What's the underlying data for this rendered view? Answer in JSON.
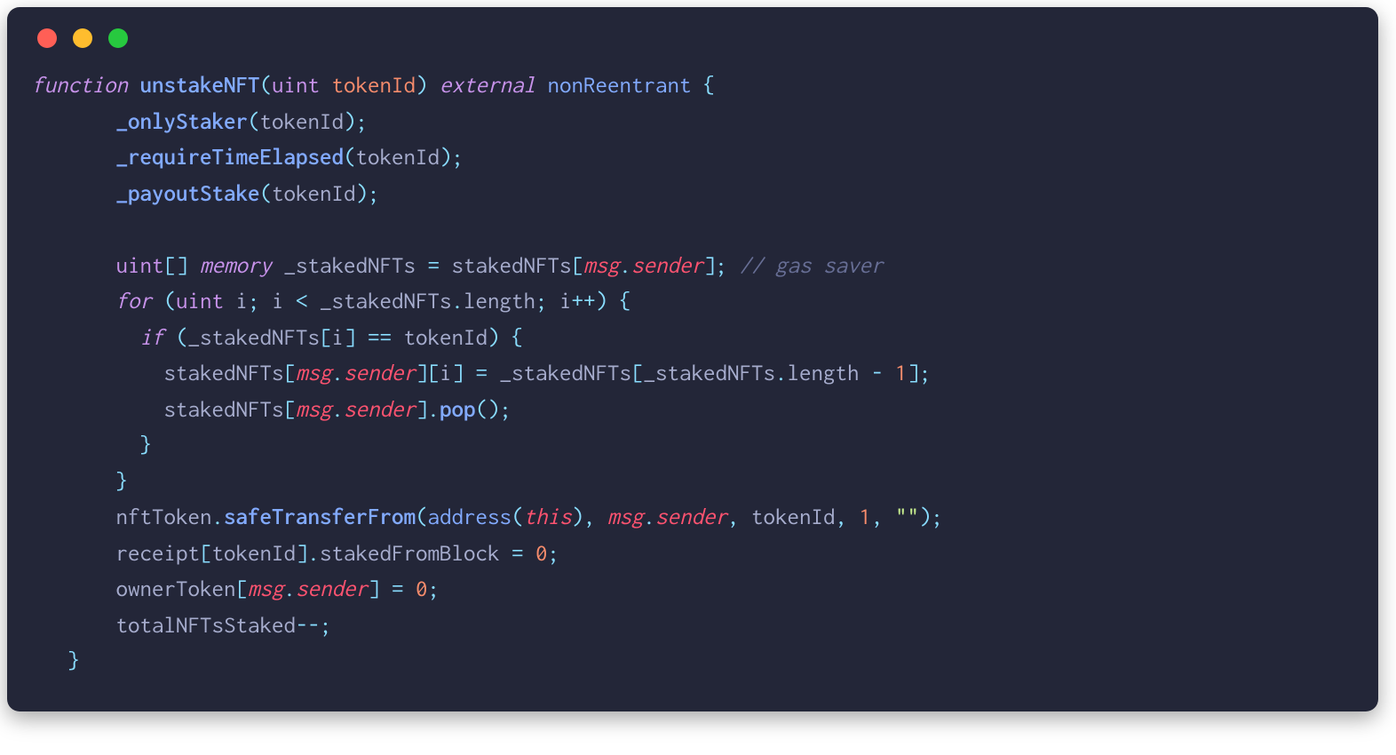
{
  "window": {
    "traffic_lights": {
      "red": "close",
      "yellow": "minimize",
      "green": "zoom"
    }
  },
  "code": {
    "lines": [
      {
        "tokens": [
          {
            "c": "tk-kw",
            "t": "function"
          },
          {
            "c": "sp",
            "t": " "
          },
          {
            "c": "tk-fnbold",
            "t": "unstakeNFT"
          },
          {
            "c": "tk-punc",
            "t": "("
          },
          {
            "c": "tk-type",
            "t": "uint"
          },
          {
            "c": "sp",
            "t": " "
          },
          {
            "c": "tk-param",
            "t": "tokenId"
          },
          {
            "c": "tk-punc",
            "t": ")"
          },
          {
            "c": "sp",
            "t": " "
          },
          {
            "c": "tk-kw",
            "t": "external"
          },
          {
            "c": "sp",
            "t": " "
          },
          {
            "c": "tk-mod",
            "t": "nonReentrant"
          },
          {
            "c": "sp",
            "t": " "
          },
          {
            "c": "tk-punc",
            "t": "{"
          }
        ]
      },
      {
        "tokens": [
          {
            "c": "sp",
            "t": "       "
          },
          {
            "c": "tk-fnbold",
            "t": "_onlyStaker"
          },
          {
            "c": "tk-punc",
            "t": "("
          },
          {
            "c": "tk-var",
            "t": "tokenId"
          },
          {
            "c": "tk-punc",
            "t": ")"
          },
          {
            "c": "tk-punc",
            "t": ";"
          }
        ]
      },
      {
        "tokens": [
          {
            "c": "sp",
            "t": "       "
          },
          {
            "c": "tk-fnbold",
            "t": "_requireTimeElapsed"
          },
          {
            "c": "tk-punc",
            "t": "("
          },
          {
            "c": "tk-var",
            "t": "tokenId"
          },
          {
            "c": "tk-punc",
            "t": ")"
          },
          {
            "c": "tk-punc",
            "t": ";"
          }
        ]
      },
      {
        "tokens": [
          {
            "c": "sp",
            "t": "       "
          },
          {
            "c": "tk-fnbold",
            "t": "_payoutStake"
          },
          {
            "c": "tk-punc",
            "t": "("
          },
          {
            "c": "tk-var",
            "t": "tokenId"
          },
          {
            "c": "tk-punc",
            "t": ")"
          },
          {
            "c": "tk-punc",
            "t": ";"
          }
        ]
      },
      {
        "tokens": [
          {
            "c": "sp",
            "t": ""
          }
        ]
      },
      {
        "tokens": [
          {
            "c": "sp",
            "t": "       "
          },
          {
            "c": "tk-type",
            "t": "uint"
          },
          {
            "c": "tk-punc",
            "t": "[]"
          },
          {
            "c": "sp",
            "t": " "
          },
          {
            "c": "tk-kw",
            "t": "memory"
          },
          {
            "c": "sp",
            "t": " "
          },
          {
            "c": "tk-var",
            "t": "_stakedNFTs"
          },
          {
            "c": "sp",
            "t": " "
          },
          {
            "c": "tk-op",
            "t": "="
          },
          {
            "c": "sp",
            "t": " "
          },
          {
            "c": "tk-var",
            "t": "stakedNFTs"
          },
          {
            "c": "tk-punc",
            "t": "["
          },
          {
            "c": "tk-spec",
            "t": "msg"
          },
          {
            "c": "tk-punc",
            "t": "."
          },
          {
            "c": "tk-member",
            "t": "sender"
          },
          {
            "c": "tk-punc",
            "t": "]"
          },
          {
            "c": "tk-punc",
            "t": ";"
          },
          {
            "c": "sp",
            "t": " "
          },
          {
            "c": "tk-comment",
            "t": "// gas saver"
          }
        ]
      },
      {
        "tokens": [
          {
            "c": "sp",
            "t": "       "
          },
          {
            "c": "tk-kw",
            "t": "for"
          },
          {
            "c": "sp",
            "t": " "
          },
          {
            "c": "tk-punc",
            "t": "("
          },
          {
            "c": "tk-type",
            "t": "uint"
          },
          {
            "c": "sp",
            "t": " "
          },
          {
            "c": "tk-var",
            "t": "i"
          },
          {
            "c": "tk-punc",
            "t": ";"
          },
          {
            "c": "sp",
            "t": " "
          },
          {
            "c": "tk-var",
            "t": "i"
          },
          {
            "c": "sp",
            "t": " "
          },
          {
            "c": "tk-op",
            "t": "<"
          },
          {
            "c": "sp",
            "t": " "
          },
          {
            "c": "tk-var",
            "t": "_stakedNFTs"
          },
          {
            "c": "tk-punc",
            "t": "."
          },
          {
            "c": "tk-prop",
            "t": "length"
          },
          {
            "c": "tk-punc",
            "t": ";"
          },
          {
            "c": "sp",
            "t": " "
          },
          {
            "c": "tk-var",
            "t": "i"
          },
          {
            "c": "tk-op",
            "t": "++"
          },
          {
            "c": "tk-punc",
            "t": ")"
          },
          {
            "c": "sp",
            "t": " "
          },
          {
            "c": "tk-punc",
            "t": "{"
          }
        ]
      },
      {
        "tokens": [
          {
            "c": "sp",
            "t": "         "
          },
          {
            "c": "tk-kw",
            "t": "if"
          },
          {
            "c": "sp",
            "t": " "
          },
          {
            "c": "tk-punc",
            "t": "("
          },
          {
            "c": "tk-var",
            "t": "_stakedNFTs"
          },
          {
            "c": "tk-punc",
            "t": "["
          },
          {
            "c": "tk-var",
            "t": "i"
          },
          {
            "c": "tk-punc",
            "t": "]"
          },
          {
            "c": "sp",
            "t": " "
          },
          {
            "c": "tk-op",
            "t": "=="
          },
          {
            "c": "sp",
            "t": " "
          },
          {
            "c": "tk-var",
            "t": "tokenId"
          },
          {
            "c": "tk-punc",
            "t": ")"
          },
          {
            "c": "sp",
            "t": " "
          },
          {
            "c": "tk-punc",
            "t": "{"
          }
        ]
      },
      {
        "tokens": [
          {
            "c": "sp",
            "t": "           "
          },
          {
            "c": "tk-var",
            "t": "stakedNFTs"
          },
          {
            "c": "tk-punc",
            "t": "["
          },
          {
            "c": "tk-spec",
            "t": "msg"
          },
          {
            "c": "tk-punc",
            "t": "."
          },
          {
            "c": "tk-member",
            "t": "sender"
          },
          {
            "c": "tk-punc",
            "t": "]"
          },
          {
            "c": "tk-punc",
            "t": "["
          },
          {
            "c": "tk-var",
            "t": "i"
          },
          {
            "c": "tk-punc",
            "t": "]"
          },
          {
            "c": "sp",
            "t": " "
          },
          {
            "c": "tk-op",
            "t": "="
          },
          {
            "c": "sp",
            "t": " "
          },
          {
            "c": "tk-var",
            "t": "_stakedNFTs"
          },
          {
            "c": "tk-punc",
            "t": "["
          },
          {
            "c": "tk-var",
            "t": "_stakedNFTs"
          },
          {
            "c": "tk-punc",
            "t": "."
          },
          {
            "c": "tk-prop",
            "t": "length"
          },
          {
            "c": "sp",
            "t": " "
          },
          {
            "c": "tk-op",
            "t": "-"
          },
          {
            "c": "sp",
            "t": " "
          },
          {
            "c": "tk-num",
            "t": "1"
          },
          {
            "c": "tk-punc",
            "t": "]"
          },
          {
            "c": "tk-punc",
            "t": ";"
          }
        ]
      },
      {
        "tokens": [
          {
            "c": "sp",
            "t": "           "
          },
          {
            "c": "tk-var",
            "t": "stakedNFTs"
          },
          {
            "c": "tk-punc",
            "t": "["
          },
          {
            "c": "tk-spec",
            "t": "msg"
          },
          {
            "c": "tk-punc",
            "t": "."
          },
          {
            "c": "tk-member",
            "t": "sender"
          },
          {
            "c": "tk-punc",
            "t": "]"
          },
          {
            "c": "tk-punc",
            "t": "."
          },
          {
            "c": "tk-fnbold",
            "t": "pop"
          },
          {
            "c": "tk-punc",
            "t": "()"
          },
          {
            "c": "tk-punc",
            "t": ";"
          }
        ]
      },
      {
        "tokens": [
          {
            "c": "sp",
            "t": "         "
          },
          {
            "c": "tk-punc",
            "t": "}"
          }
        ]
      },
      {
        "tokens": [
          {
            "c": "sp",
            "t": "       "
          },
          {
            "c": "tk-punc",
            "t": "}"
          }
        ]
      },
      {
        "tokens": [
          {
            "c": "sp",
            "t": "       "
          },
          {
            "c": "tk-var",
            "t": "nftToken"
          },
          {
            "c": "tk-punc",
            "t": "."
          },
          {
            "c": "tk-fnbold",
            "t": "safeTransferFrom"
          },
          {
            "c": "tk-punc",
            "t": "("
          },
          {
            "c": "tk-fn",
            "t": "address"
          },
          {
            "c": "tk-punc",
            "t": "("
          },
          {
            "c": "tk-spec",
            "t": "this"
          },
          {
            "c": "tk-punc",
            "t": ")"
          },
          {
            "c": "tk-punc",
            "t": ","
          },
          {
            "c": "sp",
            "t": " "
          },
          {
            "c": "tk-spec",
            "t": "msg"
          },
          {
            "c": "tk-punc",
            "t": "."
          },
          {
            "c": "tk-member",
            "t": "sender"
          },
          {
            "c": "tk-punc",
            "t": ","
          },
          {
            "c": "sp",
            "t": " "
          },
          {
            "c": "tk-var",
            "t": "tokenId"
          },
          {
            "c": "tk-punc",
            "t": ","
          },
          {
            "c": "sp",
            "t": " "
          },
          {
            "c": "tk-num",
            "t": "1"
          },
          {
            "c": "tk-punc",
            "t": ","
          },
          {
            "c": "sp",
            "t": " "
          },
          {
            "c": "tk-str",
            "t": "\"\""
          },
          {
            "c": "tk-punc",
            "t": ")"
          },
          {
            "c": "tk-punc",
            "t": ";"
          }
        ]
      },
      {
        "tokens": [
          {
            "c": "sp",
            "t": "       "
          },
          {
            "c": "tk-var",
            "t": "receipt"
          },
          {
            "c": "tk-punc",
            "t": "["
          },
          {
            "c": "tk-var",
            "t": "tokenId"
          },
          {
            "c": "tk-punc",
            "t": "]"
          },
          {
            "c": "tk-punc",
            "t": "."
          },
          {
            "c": "tk-prop",
            "t": "stakedFromBlock"
          },
          {
            "c": "sp",
            "t": " "
          },
          {
            "c": "tk-op",
            "t": "="
          },
          {
            "c": "sp",
            "t": " "
          },
          {
            "c": "tk-num",
            "t": "0"
          },
          {
            "c": "tk-punc",
            "t": ";"
          }
        ]
      },
      {
        "tokens": [
          {
            "c": "sp",
            "t": "       "
          },
          {
            "c": "tk-var",
            "t": "ownerToken"
          },
          {
            "c": "tk-punc",
            "t": "["
          },
          {
            "c": "tk-spec",
            "t": "msg"
          },
          {
            "c": "tk-punc",
            "t": "."
          },
          {
            "c": "tk-member",
            "t": "sender"
          },
          {
            "c": "tk-punc",
            "t": "]"
          },
          {
            "c": "sp",
            "t": " "
          },
          {
            "c": "tk-op",
            "t": "="
          },
          {
            "c": "sp",
            "t": " "
          },
          {
            "c": "tk-num",
            "t": "0"
          },
          {
            "c": "tk-punc",
            "t": ";"
          }
        ]
      },
      {
        "tokens": [
          {
            "c": "sp",
            "t": "       "
          },
          {
            "c": "tk-var",
            "t": "totalNFTsStaked"
          },
          {
            "c": "tk-op",
            "t": "--"
          },
          {
            "c": "tk-punc",
            "t": ";"
          }
        ]
      },
      {
        "tokens": [
          {
            "c": "sp",
            "t": "   "
          },
          {
            "c": "tk-punc",
            "t": "}"
          }
        ]
      }
    ]
  }
}
